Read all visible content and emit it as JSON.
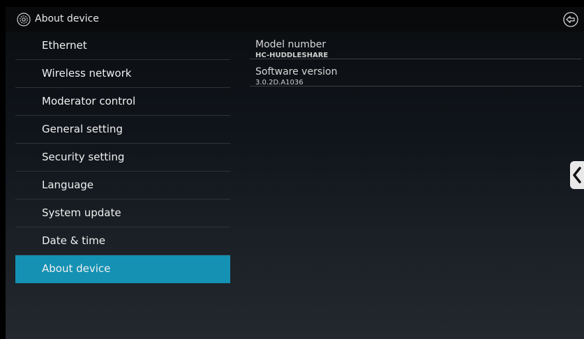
{
  "titlebar": {
    "title": "About device",
    "settings_icon": "gear-icon",
    "back_icon": "back-arrow-icon"
  },
  "sidebar": {
    "items": [
      {
        "label": "Ethernet",
        "selected": false
      },
      {
        "label": "Wireless network",
        "selected": false
      },
      {
        "label": "Moderator control",
        "selected": false
      },
      {
        "label": "General setting",
        "selected": false
      },
      {
        "label": "Security setting",
        "selected": false
      },
      {
        "label": "Language",
        "selected": false
      },
      {
        "label": "System update",
        "selected": false
      },
      {
        "label": "Date & time",
        "selected": false
      },
      {
        "label": "About device",
        "selected": true
      }
    ]
  },
  "details": {
    "model": {
      "title": "Model number",
      "value": "HC-HUDDLESHARE"
    },
    "software": {
      "title": "Software version",
      "value": "3.0.2D.A1036"
    }
  },
  "side_handle": {
    "icon": "chevron-left-icon"
  },
  "colors": {
    "accent": "#1491b3",
    "titlebar": "#090a0b",
    "text": "#f0f0f0"
  }
}
